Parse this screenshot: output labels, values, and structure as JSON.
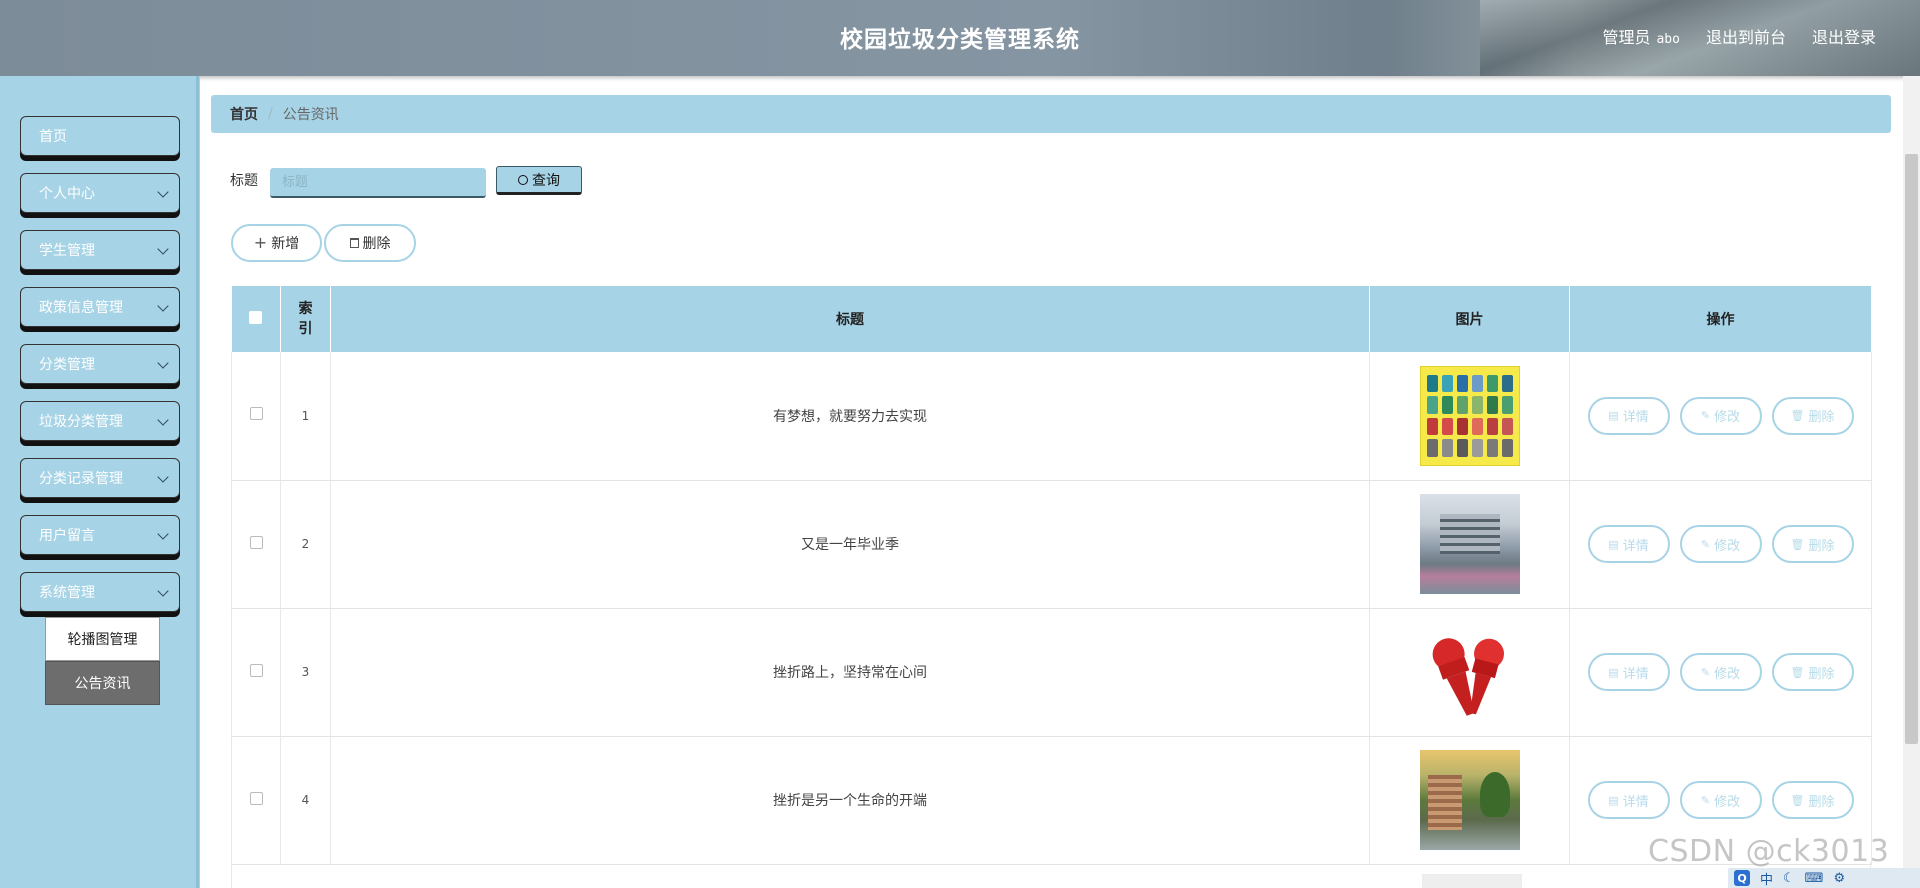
{
  "header": {
    "title": "校园垃圾分类管理系统",
    "user_label": "管理员",
    "user_name": "abo",
    "to_frontend": "退出到前台",
    "logout": "退出登录"
  },
  "sidebar": {
    "items": [
      {
        "label": "首页"
      },
      {
        "label": "个人中心"
      },
      {
        "label": "学生管理"
      },
      {
        "label": "政策信息管理"
      },
      {
        "label": "分类管理"
      },
      {
        "label": "垃圾分类管理"
      },
      {
        "label": "分类记录管理"
      },
      {
        "label": "用户留言"
      },
      {
        "label": "系统管理"
      }
    ],
    "submenu": [
      {
        "label": "轮播图管理"
      },
      {
        "label": "公告资讯"
      }
    ]
  },
  "breadcrumb": {
    "home": "首页",
    "current": "公告资讯"
  },
  "search": {
    "label": "标题",
    "placeholder": "标题",
    "button": "查询"
  },
  "actions": {
    "add": "新增",
    "delete": "删除"
  },
  "table": {
    "headers": {
      "index_1": "索",
      "index_2": "引",
      "title": "标题",
      "image": "图片",
      "ops": "操作"
    },
    "rows": [
      {
        "index": "1",
        "title": "有梦想，就要努力去实现"
      },
      {
        "index": "2",
        "title": "又是一年毕业季"
      },
      {
        "index": "3",
        "title": "挫折路上，坚持常在心间"
      },
      {
        "index": "4",
        "title": "挫折是另一个生命的开端"
      }
    ],
    "row_actions": {
      "detail": "详情",
      "edit": "修改",
      "delete": "删除"
    }
  },
  "watermark": "CSDN @ck3013",
  "tray": {
    "ime": "中"
  },
  "colors": {
    "accent": "#a7d3e6",
    "header_bg": "#7d8c99",
    "submenu_active": "#6d6d6d"
  }
}
